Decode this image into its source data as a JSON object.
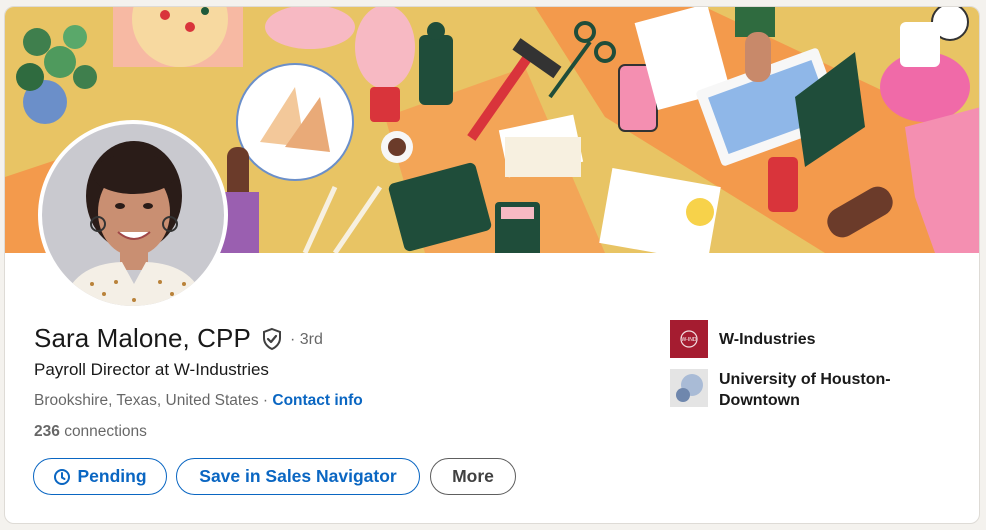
{
  "profile": {
    "name": "Sara Malone, CPP",
    "degree": "· 3rd",
    "headline": "Payroll Director at W-Industries",
    "location": "Brookshire, Texas, United States",
    "separator": "·",
    "contact_info": "Contact info",
    "connections_count": "236",
    "connections_label": "connections"
  },
  "actions": {
    "pending": "Pending",
    "save_sales_navigator": "Save in Sales Navigator",
    "more": "More"
  },
  "organizations": [
    {
      "name": "W-Industries",
      "logo": "w-industries-logo",
      "logo_color": "#a51c30"
    },
    {
      "name": "University of Houston-Downtown",
      "logo": "uhd-logo",
      "logo_color": "#8aa3c8"
    }
  ],
  "icons": {
    "verified": "shield-check-icon",
    "pending": "clock-icon"
  },
  "colors": {
    "accent": "#0a66c2",
    "banner_bg": "#e8c464"
  }
}
